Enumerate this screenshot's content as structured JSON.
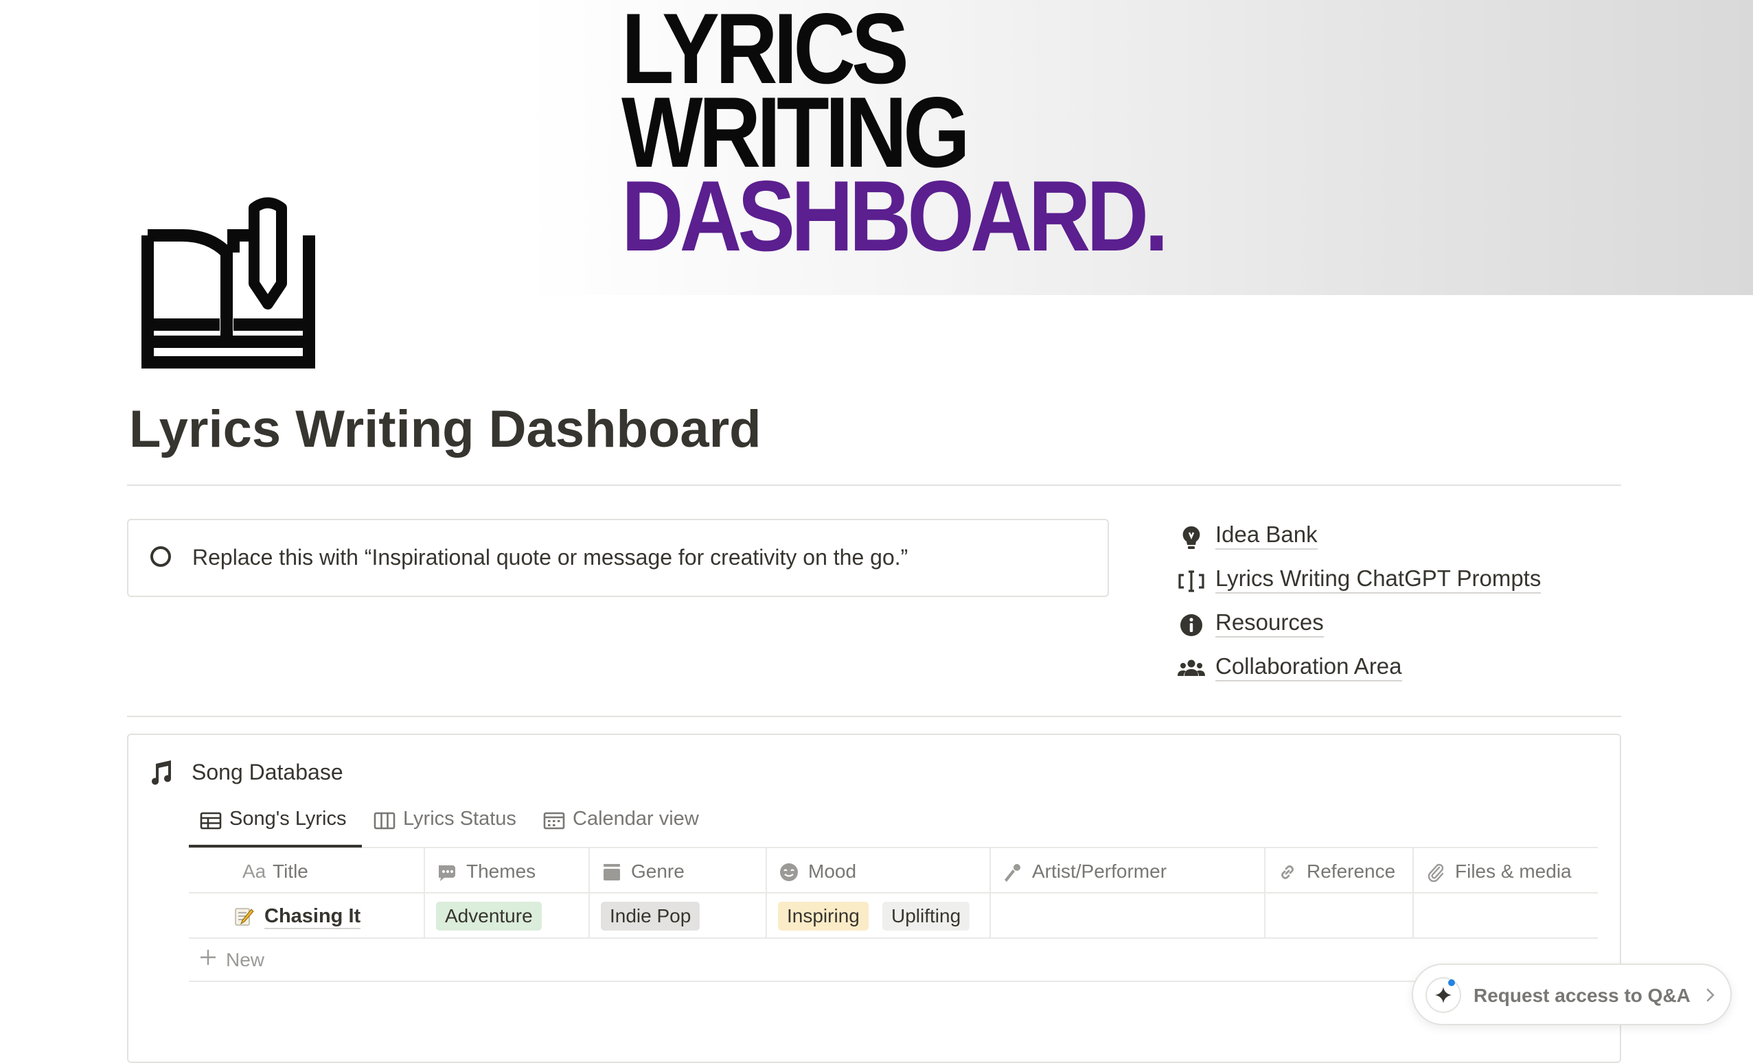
{
  "cover": {
    "line1": "LYRICS",
    "line2": "WRITING",
    "line3": "DASHBOARD.",
    "accent_color": "#5b1f8f"
  },
  "page": {
    "icon": "book-pen-icon",
    "title": "Lyrics Writing Dashboard"
  },
  "callout": {
    "icon": "circle-icon",
    "text": "Replace this with “Inspirational quote or message for creativity on the go.”"
  },
  "links": [
    {
      "icon": "lightbulb-icon",
      "label": "Idea Bank"
    },
    {
      "icon": "prompt-icon",
      "label": "Lyrics Writing ChatGPT Prompts"
    },
    {
      "icon": "info-icon",
      "label": "Resources"
    },
    {
      "icon": "people-icon",
      "label": "Collaboration Area"
    }
  ],
  "database": {
    "icon": "music-note-icon",
    "title": "Song Database",
    "tabs": [
      {
        "icon": "table-icon",
        "label": "Song's Lyrics",
        "active": true
      },
      {
        "icon": "board-icon",
        "label": "Lyrics Status",
        "active": false
      },
      {
        "icon": "calendar-icon",
        "label": "Calendar view",
        "active": false
      }
    ],
    "columns": [
      {
        "icon": "text-icon",
        "icon_text": "Aa",
        "label": "Title"
      },
      {
        "icon": "multi-select-icon",
        "label": "Themes"
      },
      {
        "icon": "select-icon",
        "label": "Genre"
      },
      {
        "icon": "mood-icon",
        "label": "Mood"
      },
      {
        "icon": "person-icon",
        "label": "Artist/Performer"
      },
      {
        "icon": "link-icon",
        "label": "Reference"
      },
      {
        "icon": "paperclip-icon",
        "label": "Files & media"
      }
    ],
    "rows": [
      {
        "icon": "memo-icon",
        "title": "Chasing It",
        "themes": [
          "Adventure"
        ],
        "genre": [
          "Indie Pop"
        ],
        "mood": [
          "Inspiring",
          "Uplifting"
        ],
        "artist": "",
        "reference": "",
        "files": ""
      }
    ],
    "new_label": "New"
  },
  "qa_button": {
    "icon": "sparkle-icon",
    "label": "Request access to Q&A"
  },
  "colors": {
    "text": "#37352f",
    "muted": "#787774",
    "tag_green": "#dbeddb",
    "tag_gray": "#e3e2e0",
    "tag_yellow": "#fbecc8",
    "tag_light_gray": "#efefed"
  }
}
